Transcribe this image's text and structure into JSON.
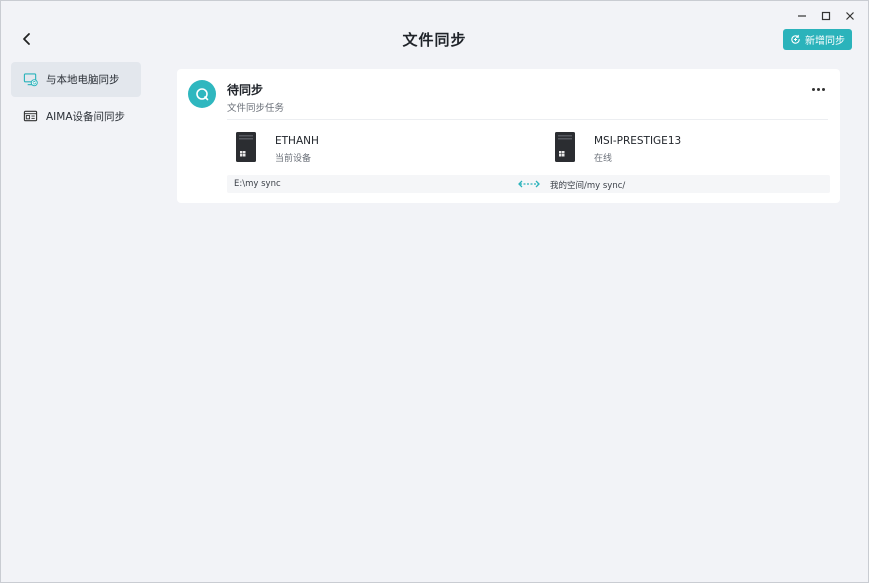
{
  "window": {
    "controls": [
      "minimize-icon",
      "maximize-icon",
      "close-icon"
    ]
  },
  "header": {
    "title": "文件同步",
    "add_sync_label": "新增同步",
    "accent_color": "#2bb3bb"
  },
  "sidebar": {
    "items": [
      {
        "label": "与本地电脑同步",
        "icon": "computer-sync-icon",
        "active": true
      },
      {
        "label": "AIMA设备间同步",
        "icon": "device-sync-icon",
        "active": false
      }
    ]
  },
  "card": {
    "title": "待同步",
    "subtitle": "文件同步任务",
    "status_icon": "sync-pending-icon",
    "source_device": {
      "name": "ETHANH",
      "state": "当前设备",
      "path": "E:\\my sync"
    },
    "target_device": {
      "name": "MSI-PRESTIGE13",
      "state": "在线",
      "path": "我的空间/my sync/"
    },
    "direction_icon": "bidirectional-arrow-icon"
  }
}
